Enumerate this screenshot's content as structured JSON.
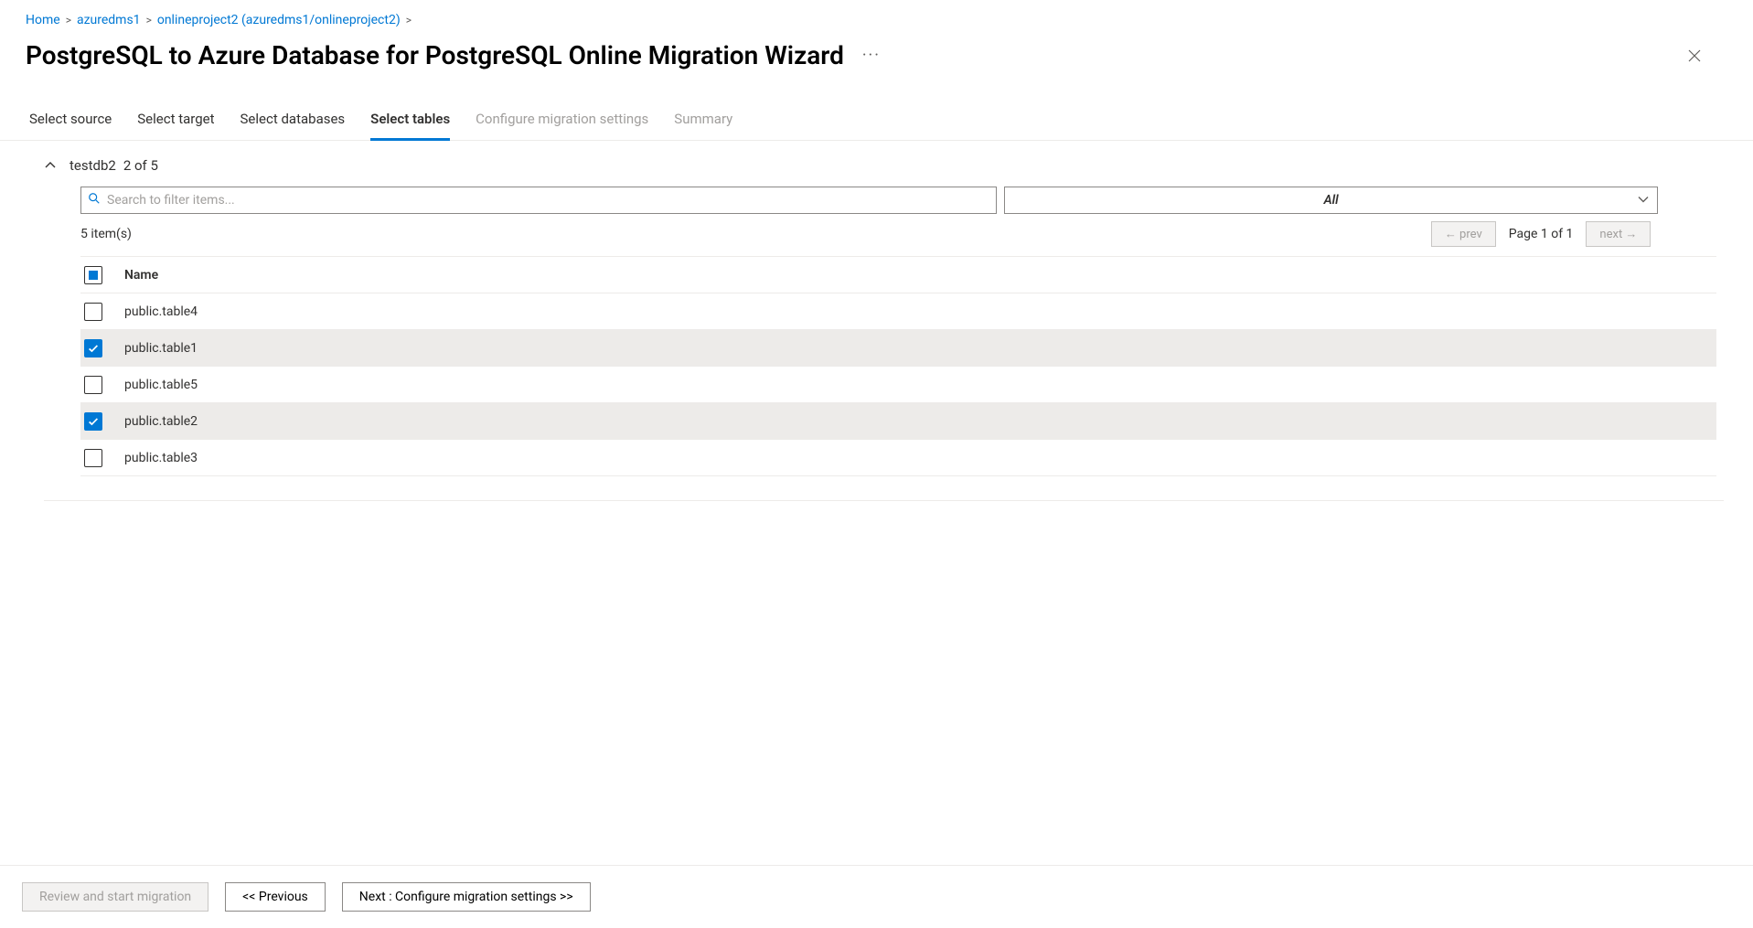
{
  "breadcrumb": {
    "items": [
      {
        "label": "Home"
      },
      {
        "label": "azuredms1"
      },
      {
        "label": "onlineproject2 (azuredms1/onlineproject2)"
      }
    ],
    "sep": ">"
  },
  "title": "PostgreSQL to Azure Database for PostgreSQL Online Migration Wizard",
  "more_label": "···",
  "tabs": [
    {
      "label": "Select source",
      "state": "normal"
    },
    {
      "label": "Select target",
      "state": "normal"
    },
    {
      "label": "Select databases",
      "state": "normal"
    },
    {
      "label": "Select tables",
      "state": "active"
    },
    {
      "label": "Configure migration settings",
      "state": "disabled"
    },
    {
      "label": "Summary",
      "state": "disabled"
    }
  ],
  "accordion": {
    "db_name": "testdb2",
    "suffix": "2 of 5"
  },
  "search": {
    "placeholder": "Search to filter items..."
  },
  "filter_select": {
    "value": "All"
  },
  "count_text": "5 item(s)",
  "pager": {
    "prev": "← prev",
    "page": "Page 1 of 1",
    "next": "next →"
  },
  "columns": {
    "name": "Name"
  },
  "rows": [
    {
      "name": "public.table4",
      "checked": false
    },
    {
      "name": "public.table1",
      "checked": true
    },
    {
      "name": "public.table5",
      "checked": false
    },
    {
      "name": "public.table2",
      "checked": true
    },
    {
      "name": "public.table3",
      "checked": false
    }
  ],
  "footer": {
    "review": "Review and start migration",
    "prev": "<< Previous",
    "next": "Next : Configure migration settings >>"
  }
}
